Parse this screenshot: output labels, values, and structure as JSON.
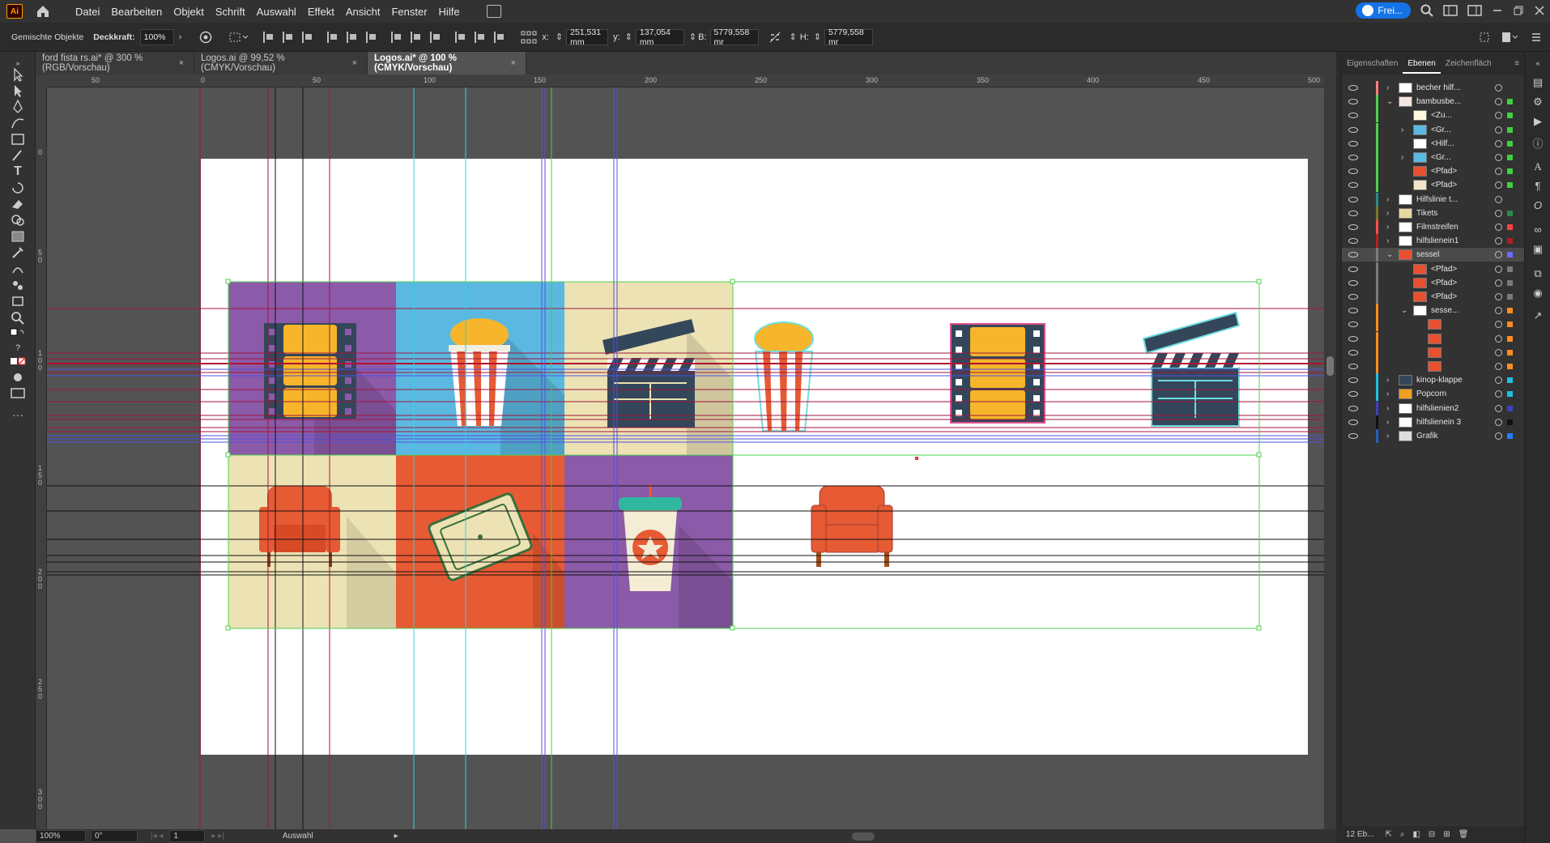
{
  "menubar": {
    "logo": "Ai",
    "items": [
      "Datei",
      "Bearbeiten",
      "Objekt",
      "Schrift",
      "Auswahl",
      "Effekt",
      "Ansicht",
      "Fenster",
      "Hilfe"
    ],
    "share_label": "Frei..."
  },
  "control": {
    "selection_label": "Gemischte Objekte",
    "opacity_label": "Deckkraft:",
    "opacity_value": "100%",
    "x_label": "x:",
    "x_value": "251,531 mm",
    "y_label": "y:",
    "y_value": "137,054 mm",
    "w_label": "B:",
    "w_value": "5779,558 mr",
    "h_label": "H:",
    "h_value": "5779,558 mr"
  },
  "tabs": [
    {
      "label": "ford fista rs.ai* @ 300 % (RGB/Vorschau)",
      "close": "×"
    },
    {
      "label": "Logos.ai @ 99,52 % (CMYK/Vorschau)",
      "close": "×"
    },
    {
      "label": "Logos.ai* @ 100 % (CMYK/Vorschau)",
      "close": "×"
    }
  ],
  "ruler": {
    "h_ticks": [
      "50",
      "0",
      "50",
      "100",
      "150",
      "200",
      "250",
      "300",
      "350",
      "400",
      "450",
      "500"
    ],
    "v_ticks": [
      "0",
      "5\n0",
      "1\n0\n0",
      "1\n5\n0",
      "2\n0\n0",
      "2\n5\n0",
      "3\n0\n0"
    ]
  },
  "status": {
    "zoom": "100%",
    "rotation": "0°",
    "artboard_num": "1",
    "mode": "Auswahl"
  },
  "layers_panel": {
    "tabs": [
      "Eigenschaften",
      "Ebenen",
      "Zeichenfläch"
    ],
    "rows": [
      {
        "name": "becher hilf...",
        "color": "#ff7f7f",
        "indent": 0,
        "chev": "›",
        "thumb": "#ffffff",
        "sq": ""
      },
      {
        "name": "bambusbe...",
        "color": "#4fd04f",
        "indent": 0,
        "chev": "⌄",
        "thumb": "#f4e6e0",
        "sq": "#3fd03f"
      },
      {
        "name": "<Zu...",
        "color": "#4fd04f",
        "indent": 1,
        "chev": "",
        "thumb": "#fff7e0",
        "sq": "#3fd03f"
      },
      {
        "name": "<Gr...",
        "color": "#4fd04f",
        "indent": 1,
        "chev": "›",
        "thumb": "#5bb8e0",
        "sq": "#3fd03f"
      },
      {
        "name": "<Hilf...",
        "color": "#4fd04f",
        "indent": 1,
        "chev": "",
        "thumb": "#ffffff",
        "sq": "#3fd03f"
      },
      {
        "name": "<Gr...",
        "color": "#4fd04f",
        "indent": 1,
        "chev": "›",
        "thumb": "#5bb8e0",
        "sq": "#3fd03f"
      },
      {
        "name": "<Pfad>",
        "color": "#4fd04f",
        "indent": 1,
        "chev": "",
        "thumb": "#e85030",
        "sq": "#3fd03f"
      },
      {
        "name": "<Pfad>",
        "color": "#4fd04f",
        "indent": 1,
        "chev": "",
        "thumb": "#f3e6c8",
        "sq": "#3fd03f"
      },
      {
        "name": "Hilfslinie t...",
        "color": "#2a8a8a",
        "indent": 0,
        "chev": "›",
        "thumb": "#ffffff",
        "sq": ""
      },
      {
        "name": "Tikets",
        "color": "#7a7a2a",
        "indent": 0,
        "chev": "›",
        "thumb": "#e8d8a0",
        "sq": "#2a8a4a"
      },
      {
        "name": "Filmstreifen",
        "color": "#ff5050",
        "indent": 0,
        "chev": "›",
        "thumb": "#ffffff",
        "sq": "#ff4040"
      },
      {
        "name": "hilfslienein1",
        "color": "#b02020",
        "indent": 0,
        "chev": "›",
        "thumb": "#ffffff",
        "sq": "#b02020"
      },
      {
        "name": "sessel",
        "color": "#7a7a7a",
        "indent": 0,
        "chev": "⌄",
        "thumb": "#e85030",
        "sq": "#6a6aff",
        "sel": true
      },
      {
        "name": "<Pfad>",
        "color": "#7a7a7a",
        "indent": 1,
        "chev": "",
        "thumb": "#e85030",
        "sq": "#7a7a7a"
      },
      {
        "name": "<Pfad>",
        "color": "#7a7a7a",
        "indent": 1,
        "chev": "",
        "thumb": "#e85030",
        "sq": "#7a7a7a"
      },
      {
        "name": "<Pfad>",
        "color": "#7a7a7a",
        "indent": 1,
        "chev": "",
        "thumb": "#e85030",
        "sq": "#7a7a7a"
      },
      {
        "name": "sesse...",
        "color": "#ff8c20",
        "indent": 1,
        "chev": "⌄",
        "thumb": "#ffffff",
        "sq": "#ff8c20"
      },
      {
        "name": "",
        "color": "#ff8c20",
        "indent": 2,
        "chev": "",
        "thumb": "#e85030",
        "sq": "#ff8c20"
      },
      {
        "name": "",
        "color": "#ff8c20",
        "indent": 2,
        "chev": "",
        "thumb": "#e85030",
        "sq": "#ff8c20"
      },
      {
        "name": "",
        "color": "#ff8c20",
        "indent": 2,
        "chev": "",
        "thumb": "#e85030",
        "sq": "#ff8c20"
      },
      {
        "name": "",
        "color": "#ff8c20",
        "indent": 2,
        "chev": "",
        "thumb": "#e85030",
        "sq": "#ff8c20"
      },
      {
        "name": "kinop-klappe",
        "color": "#20c0e0",
        "indent": 0,
        "chev": "›",
        "thumb": "#34475a",
        "sq": "#20c0e0"
      },
      {
        "name": "Popcorn",
        "color": "#20c0e0",
        "indent": 0,
        "chev": "›",
        "thumb": "#f0a020",
        "sq": "#20c0e0"
      },
      {
        "name": "hilfslienien2",
        "color": "#4040c0",
        "indent": 0,
        "chev": "›",
        "thumb": "#ffffff",
        "sq": "#4040c0"
      },
      {
        "name": "hilfslienein 3",
        "color": "#111111",
        "indent": 0,
        "chev": "›",
        "thumb": "#ffffff",
        "sq": "#111111"
      },
      {
        "name": "Grafik",
        "color": "#2060c0",
        "indent": 0,
        "chev": "›",
        "thumb": "#dddddd",
        "sq": "#2080ff"
      }
    ],
    "footer_count": "12 Eb..."
  },
  "colors": {
    "purple": "#8b5aa8",
    "blue": "#5bb8e0",
    "cream": "#ece2b4",
    "red": "#e65a34",
    "navy": "#34475a",
    "gold": "#f6b52a",
    "guide_red": "#a0163c",
    "guide_cyan": "#30d0e0",
    "guide_blue": "#5050e0",
    "guide_green": "#40d040"
  }
}
